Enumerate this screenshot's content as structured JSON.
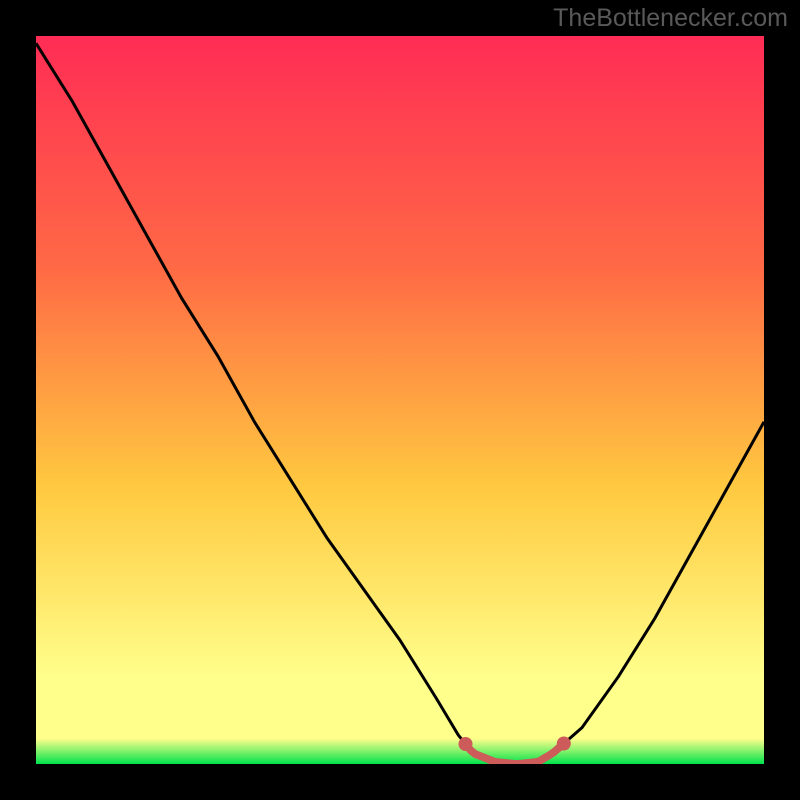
{
  "watermark": "TheBottlenecker.com",
  "chart_data": {
    "type": "line",
    "title": "",
    "xlabel": "",
    "ylabel": "",
    "xlim": [
      0,
      100
    ],
    "ylim": [
      0,
      100
    ],
    "background_gradient_colors": [
      "#00e34a",
      "#ffff8b",
      "#ffc940",
      "#ff6a45",
      "#ff2c55"
    ],
    "x": [
      0,
      5,
      10,
      15,
      20,
      25,
      30,
      35,
      40,
      45,
      50,
      55,
      58,
      60,
      63,
      66,
      69,
      71,
      75,
      80,
      85,
      90,
      95,
      100
    ],
    "values": [
      99,
      91,
      82,
      73,
      64,
      56,
      47,
      39,
      31,
      24,
      17,
      9,
      4,
      1.5,
      0.3,
      0,
      0.3,
      1.5,
      5,
      12,
      20,
      29,
      38,
      47
    ],
    "flat_region_x": [
      59,
      72.5
    ],
    "flat_region_marker_radius_px": 7,
    "flat_region_color": "#cc5b59"
  }
}
